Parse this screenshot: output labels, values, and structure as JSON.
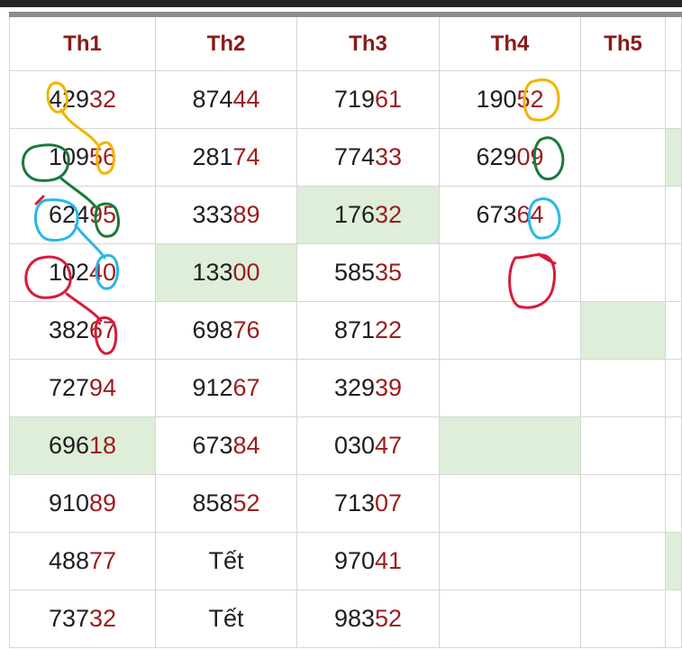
{
  "headers": [
    "Th1",
    "Th2",
    "Th3",
    "Th4",
    "Th5"
  ],
  "rows": [
    {
      "cells": [
        {
          "head": "429",
          "tail": "32"
        },
        {
          "head": "874",
          "tail": "44"
        },
        {
          "head": "719",
          "tail": "61"
        },
        {
          "head": "190",
          "tail": "52"
        },
        {
          "head": "",
          "tail": ""
        },
        {
          "head": "",
          "tail": ""
        }
      ]
    },
    {
      "cells": [
        {
          "head": "109",
          "tail": "56"
        },
        {
          "head": "281",
          "tail": "74"
        },
        {
          "head": "774",
          "tail": "33"
        },
        {
          "head": "629",
          "tail": "09"
        },
        {
          "head": "",
          "tail": ""
        },
        {
          "head": "",
          "tail": ""
        }
      ]
    },
    {
      "cells": [
        {
          "head": "624",
          "tail": "95"
        },
        {
          "head": "333",
          "tail": "89"
        },
        {
          "head": "176",
          "tail": "32"
        },
        {
          "head": "673",
          "tail": "64"
        },
        {
          "head": "",
          "tail": ""
        },
        {
          "head": "",
          "tail": ""
        }
      ]
    },
    {
      "cells": [
        {
          "head": "102",
          "tail": "40"
        },
        {
          "head": "133",
          "tail": "00"
        },
        {
          "head": "585",
          "tail": "35"
        },
        {
          "head": "",
          "tail": ""
        },
        {
          "head": "",
          "tail": ""
        },
        {
          "head": "",
          "tail": ""
        }
      ]
    },
    {
      "cells": [
        {
          "head": "382",
          "tail": "67"
        },
        {
          "head": "698",
          "tail": "76"
        },
        {
          "head": "871",
          "tail": "22"
        },
        {
          "head": "",
          "tail": ""
        },
        {
          "head": "",
          "tail": ""
        },
        {
          "head": "",
          "tail": ""
        }
      ]
    },
    {
      "cells": [
        {
          "head": "727",
          "tail": "94"
        },
        {
          "head": "912",
          "tail": "67"
        },
        {
          "head": "329",
          "tail": "39"
        },
        {
          "head": "",
          "tail": ""
        },
        {
          "head": "",
          "tail": ""
        },
        {
          "head": "",
          "tail": ""
        }
      ]
    },
    {
      "cells": [
        {
          "head": "696",
          "tail": "18"
        },
        {
          "head": "673",
          "tail": "84"
        },
        {
          "head": "030",
          "tail": "47"
        },
        {
          "head": "",
          "tail": ""
        },
        {
          "head": "",
          "tail": ""
        },
        {
          "head": "",
          "tail": ""
        }
      ]
    },
    {
      "cells": [
        {
          "head": "910",
          "tail": "89"
        },
        {
          "head": "858",
          "tail": "52"
        },
        {
          "head": "713",
          "tail": "07"
        },
        {
          "head": "",
          "tail": ""
        },
        {
          "head": "",
          "tail": ""
        },
        {
          "head": "",
          "tail": ""
        }
      ]
    },
    {
      "cells": [
        {
          "head": "488",
          "tail": "77"
        },
        {
          "head": "Tết",
          "tail": ""
        },
        {
          "head": "970",
          "tail": "41"
        },
        {
          "head": "",
          "tail": ""
        },
        {
          "head": "",
          "tail": ""
        },
        {
          "head": "",
          "tail": ""
        }
      ]
    },
    {
      "cells": [
        {
          "head": "737",
          "tail": "32"
        },
        {
          "head": "Tết",
          "tail": ""
        },
        {
          "head": "983",
          "tail": "52"
        },
        {
          "head": "",
          "tail": ""
        },
        {
          "head": "",
          "tail": ""
        },
        {
          "head": "",
          "tail": ""
        }
      ]
    }
  ],
  "highlighted_cells": [
    [
      1,
      5
    ],
    [
      2,
      2
    ],
    [
      3,
      1
    ],
    [
      4,
      4
    ],
    [
      6,
      0
    ],
    [
      6,
      3
    ],
    [
      8,
      5
    ]
  ],
  "colors": {
    "header_text": "#8b1a1a",
    "tail_digits": "#9b1c1c",
    "highlight": "#deeed8",
    "annotation_yellow": "#f2b400",
    "annotation_green": "#1a7a3a",
    "annotation_blue": "#29b6e8",
    "annotation_red": "#d81b3a"
  }
}
